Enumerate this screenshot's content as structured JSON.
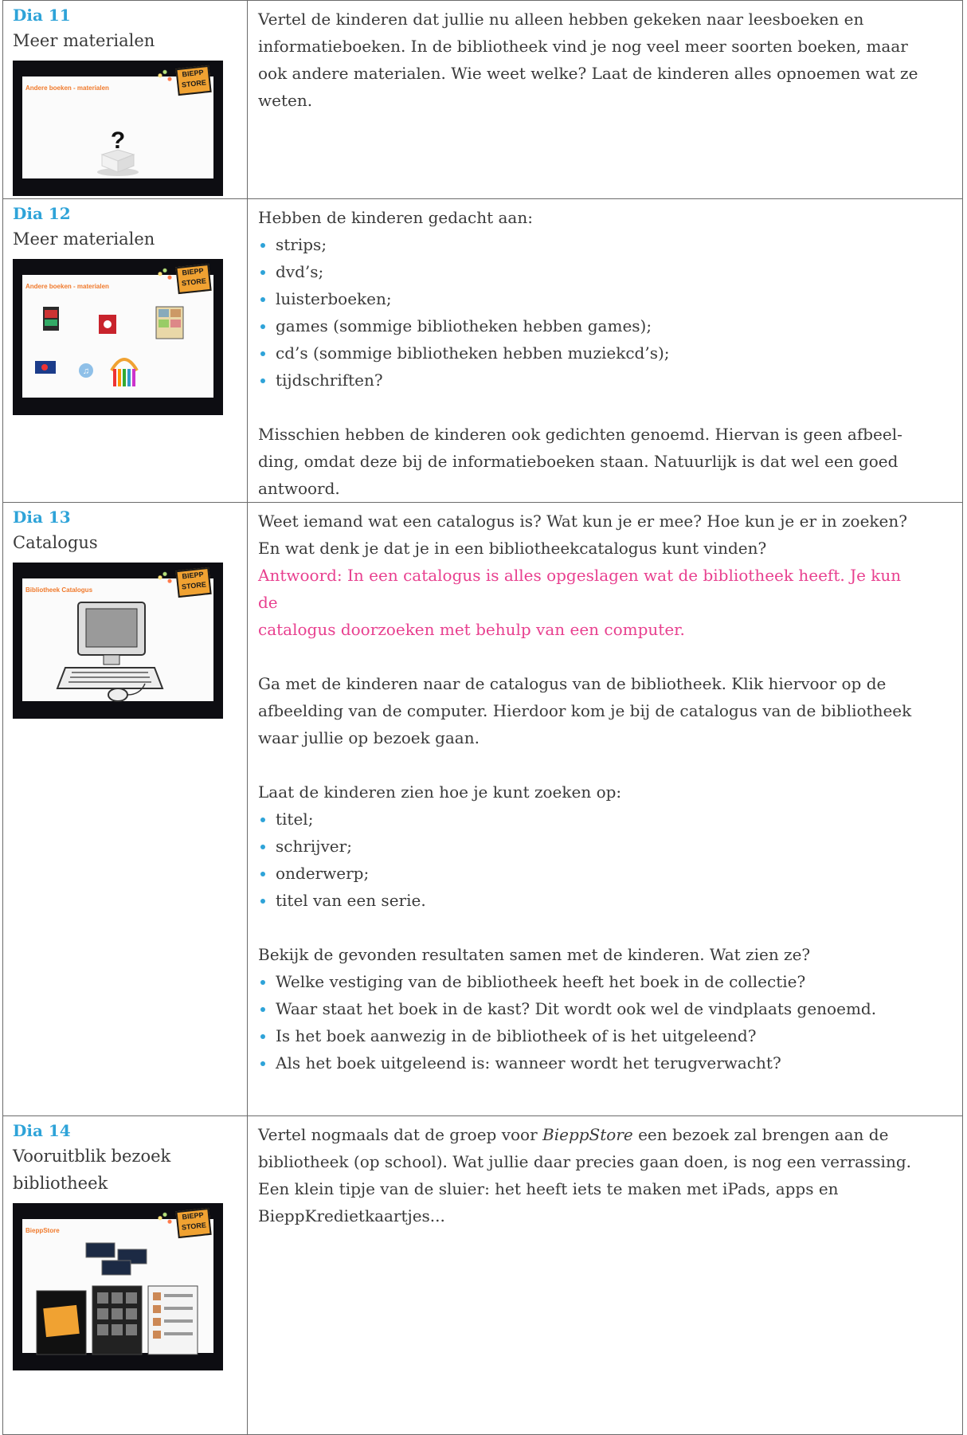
{
  "rows": [
    {
      "dia": "Dia 11",
      "subtitle": "Meer materialen",
      "thumb_title": "Andere boeken - materialen",
      "thumb_icon": "question-mark-box-icon",
      "paragraphs": [
        "Vertel de kinderen dat jullie nu alleen hebben gekeken naar leesboeken en",
        "informatieboeken. In de bibliotheek vind je nog veel meer soorten boeken, maar",
        "ook andere materialen. Wie weet welke? Laat de kinderen alles opnoemen wat ze",
        "weten."
      ]
    },
    {
      "dia": "Dia 12",
      "subtitle": "Meer materialen",
      "thumb_title": "Andere boeken - materialen",
      "intro": "Hebben de kinderen gedacht aan:",
      "bullets": [
        "strips;",
        "dvd’s;",
        "luisterboeken;",
        "games (sommige bibliotheken hebben games);",
        "cd’s (sommige bibliotheken hebben muziekcd’s);",
        "tijdschriften?"
      ],
      "outro": [
        "Misschien hebben de kinderen ook gedichten genoemd. Hiervan is geen afbeel-",
        "ding, omdat deze bij de informatieboeken staan. Natuurlijk is dat wel een goed",
        "antwoord."
      ]
    },
    {
      "dia": "Dia 13",
      "subtitle": "Catalogus",
      "thumb_title": "Bibliotheek Catalogus",
      "q1": "Weet iemand wat een catalogus is? Wat kun je er mee? Hoe kun je er in zoeken?",
      "q2": "En wat denk je dat je in een bibliotheekcatalogus kunt vinden?",
      "answer": [
        "Antwoord: In een catalogus is alles opgeslagen wat de bibliotheek heeft. Je kun",
        "de",
        "catalogus doorzoeken met behulp van een computer."
      ],
      "p2": [
        "Ga met de kinderen naar de catalogus van de bibliotheek. Klik hiervoor op de",
        "afbeelding van de computer. Hierdoor kom je bij de catalogus van de bibliotheek",
        "waar jullie op bezoek gaan."
      ],
      "search_intro": "Laat de kinderen zien hoe je kunt zoeken op:",
      "search_bullets": [
        "titel;",
        "schrijver;",
        "onderwerp;",
        "titel van een serie."
      ],
      "results_intro": "Bekijk de gevonden resultaten samen met de kinderen. Wat zien ze?",
      "results_bullets": [
        "Welke vestiging van de bibliotheek heeft het boek in de collectie?",
        "Waar staat het boek in de kast? Dit wordt ook wel de vindplaats genoemd.",
        "Is het boek aanwezig in de bibliotheek of is het uitgeleend?",
        "Als het boek uitgeleend is: wanneer wordt het terugverwacht?"
      ]
    },
    {
      "dia": "Dia 14",
      "subtitle_lines": [
        "Vooruitblik bezoek",
        "bibliotheek"
      ],
      "thumb_title": "BieppStore",
      "line1_pre": "Vertel nogmaals dat de groep voor ",
      "line1_em": "BieppStore",
      "line1_post": " een bezoek zal brengen aan de",
      "lines": [
        "bibliotheek (op school). Wat jullie daar precies gaan doen, is nog een verrassing.",
        "Een klein tipje van de sluier: het heeft iets te maken met iPads, apps en",
        "BieppKredietkaartjes..."
      ]
    }
  ],
  "logo_text": "BIEPP STORE"
}
